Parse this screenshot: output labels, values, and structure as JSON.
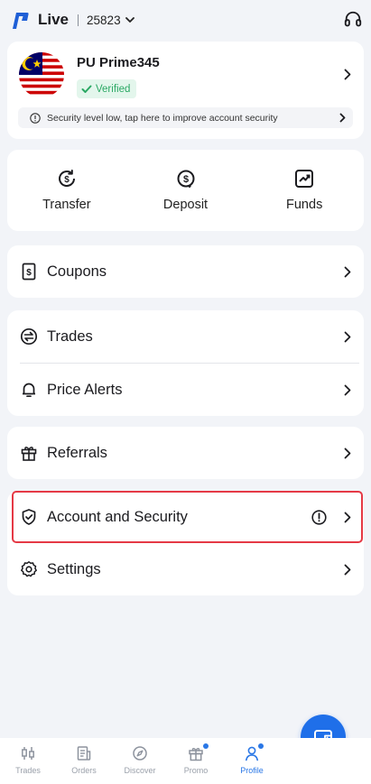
{
  "header": {
    "mode": "Live",
    "account_number": "25823"
  },
  "profile": {
    "name": "PU Prime345",
    "verified_label": "Verified",
    "security_notice": "Security level low, tap here to improve account security"
  },
  "quick_actions": [
    {
      "label": "Transfer",
      "icon": "transfer-icon"
    },
    {
      "label": "Deposit",
      "icon": "deposit-icon"
    },
    {
      "label": "Funds",
      "icon": "funds-icon"
    }
  ],
  "menu": {
    "coupons": "Coupons",
    "trades": "Trades",
    "price_alerts": "Price Alerts",
    "referrals": "Referrals",
    "account_security": "Account and Security",
    "settings": "Settings"
  },
  "bottom_nav": [
    {
      "label": "Trades",
      "icon": "candlestick-icon",
      "active": false
    },
    {
      "label": "Orders",
      "icon": "orders-icon",
      "active": false
    },
    {
      "label": "Discover",
      "icon": "compass-icon",
      "active": false
    },
    {
      "label": "Promo",
      "icon": "gift-icon",
      "active": false
    },
    {
      "label": "Profile",
      "icon": "user-icon",
      "active": true
    }
  ],
  "colors": {
    "accent": "#2a77e6",
    "verified": "#2aa863",
    "highlight": "#e53945",
    "background": "#f2f4f8"
  }
}
